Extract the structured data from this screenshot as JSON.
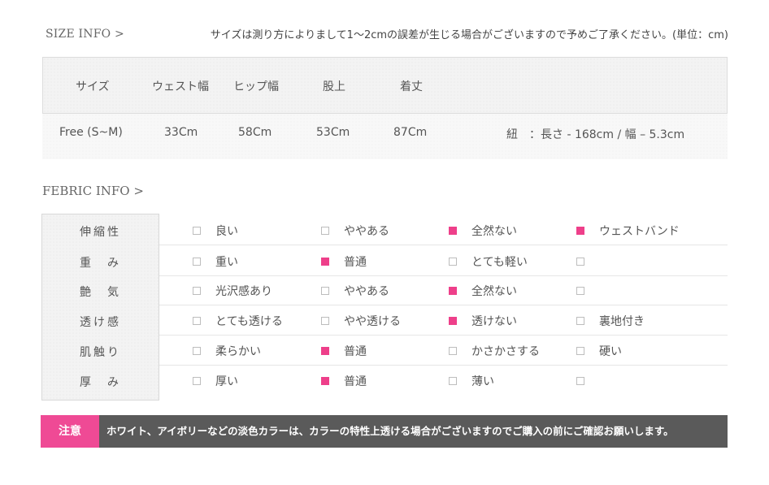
{
  "size_info": {
    "title": "SIZE INFO >",
    "note": "サイズは測り方によりまして1～2cmの誤差が生じる場合がございますので予めご了承ください。(単位：cm)",
    "headers": [
      "サイズ",
      "ウェスト幅",
      "ヒップ幅",
      "股上",
      "着丈"
    ],
    "values": [
      "Free (S~M)",
      "33Cm",
      "58Cm",
      "53Cm",
      "87Cm"
    ],
    "extra": "紐　：長さ - 168cm / 幅 – 5.3cm"
  },
  "fabric_info": {
    "title": "FEBRIC INFO >",
    "rows": [
      {
        "label": "伸縮性",
        "options": [
          {
            "text": "良い",
            "checked": false
          },
          {
            "text": "ややある",
            "checked": false
          },
          {
            "text": "全然ない",
            "checked": true
          },
          {
            "text": "ウェストバンド",
            "checked": true
          }
        ]
      },
      {
        "label": "重　み",
        "options": [
          {
            "text": "重い",
            "checked": false
          },
          {
            "text": "普通",
            "checked": true
          },
          {
            "text": "とても軽い",
            "checked": false
          },
          {
            "text": "",
            "checked": false
          }
        ]
      },
      {
        "label": "艶　気",
        "options": [
          {
            "text": "光沢感あり",
            "checked": false
          },
          {
            "text": "ややある",
            "checked": false
          },
          {
            "text": "全然ない",
            "checked": true
          },
          {
            "text": "",
            "checked": false
          }
        ]
      },
      {
        "label": "透け感",
        "options": [
          {
            "text": "とても透ける",
            "checked": false
          },
          {
            "text": "やや透ける",
            "checked": false
          },
          {
            "text": "透けない",
            "checked": true
          },
          {
            "text": "裏地付き",
            "checked": false
          }
        ]
      },
      {
        "label": "肌触り",
        "options": [
          {
            "text": "柔らかい",
            "checked": false
          },
          {
            "text": "普通",
            "checked": true
          },
          {
            "text": "かさかさする",
            "checked": false
          },
          {
            "text": "硬い",
            "checked": false
          }
        ]
      },
      {
        "label": "厚　み",
        "options": [
          {
            "text": "厚い",
            "checked": false
          },
          {
            "text": "普通",
            "checked": true
          },
          {
            "text": "薄い",
            "checked": false
          },
          {
            "text": "",
            "checked": false
          }
        ]
      }
    ]
  },
  "notice": {
    "badge": "注意",
    "text": "ホワイト、アイボリーなどの淡色カラーは、カラーの特性上透ける場合がございますのでご購入の前にご確認お願いします。"
  },
  "colors": {
    "accent": "#ee3f8a",
    "notice_bg": "#5a5a5a"
  }
}
